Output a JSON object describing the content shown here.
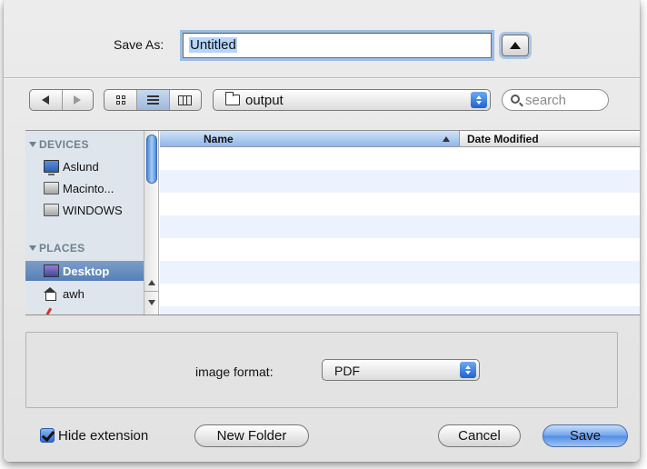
{
  "save_as": {
    "label": "Save As:",
    "filename": "Untitled"
  },
  "toolbar": {
    "location": "output",
    "search_placeholder": "search"
  },
  "sidebar": {
    "devices_header": "DEVICES",
    "devices": [
      {
        "label": "Aslund",
        "icon": "monitor-icon"
      },
      {
        "label": "Macinto...",
        "icon": "hard-drive-icon"
      },
      {
        "label": "WINDOWS",
        "icon": "hard-drive-icon"
      }
    ],
    "places_header": "PLACES",
    "places": [
      {
        "label": "Desktop",
        "icon": "desktop-icon",
        "selected": true
      },
      {
        "label": "awh",
        "icon": "home-icon",
        "selected": false
      }
    ]
  },
  "file_list": {
    "columns": [
      "Name",
      "Date Modified"
    ],
    "rows": []
  },
  "accessory": {
    "format_label": "image format:",
    "format_value": "PDF"
  },
  "footer": {
    "hide_extension_label": "Hide extension",
    "hide_extension_checked": true,
    "new_folder_label": "New Folder",
    "cancel_label": "Cancel",
    "save_label": "Save"
  },
  "colors": {
    "accent": "#4f8de6",
    "sidebar_bg": "#dfe5ec",
    "selection": "#5680b6"
  }
}
